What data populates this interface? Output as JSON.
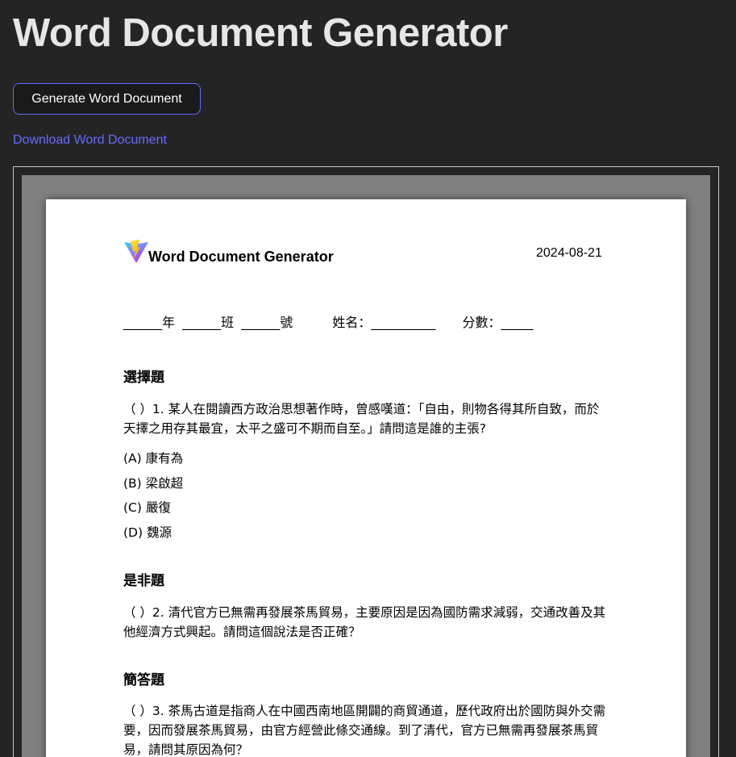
{
  "app": {
    "title": "Word Document Generator",
    "generate_button": "Generate Word Document",
    "download_link": "Download Word Document"
  },
  "colors": {
    "background": "#242424",
    "accent": "#646cff",
    "preview_bg": "#808080",
    "page_bg": "#ffffff"
  },
  "doc": {
    "logo_icon": "vite-logo-icon",
    "header_title": "Word Document Generator",
    "date": "2024-08-21",
    "info_line": {
      "grade": "______年",
      "class": "______班",
      "number": "______號",
      "name": "姓名：__________",
      "score": "分數：_____"
    },
    "sections": [
      {
        "title": "選擇題",
        "question": "（ ）1. 某人在閱讀西方政治思想著作時，曾感嘆道：「自由，則物各得其所自致，而於天擇之用存其最宜，太平之盛可不期而自至。」請問這是誰的主張?",
        "options": [
          "(A) 康有為",
          "(B) 梁啟超",
          "(C) 嚴復",
          "(D) 魏源"
        ]
      },
      {
        "title": "是非題",
        "question": "（ ）2. 清代官方已無需再發展茶馬貿易，主要原因是因為國防需求減弱，交通改善及其他經濟方式興起。請問這個說法是否正確？"
      },
      {
        "title": "簡答題",
        "question": "（ ）3. 茶馬古道是指商人在中國西南地區開闢的商貿通道，歷代政府出於國防與外交需要，因而發展茶馬貿易，由官方經營此條交通線。到了清代，官方已無需再發展茶馬貿易，請問其原因為何？"
      }
    ]
  }
}
